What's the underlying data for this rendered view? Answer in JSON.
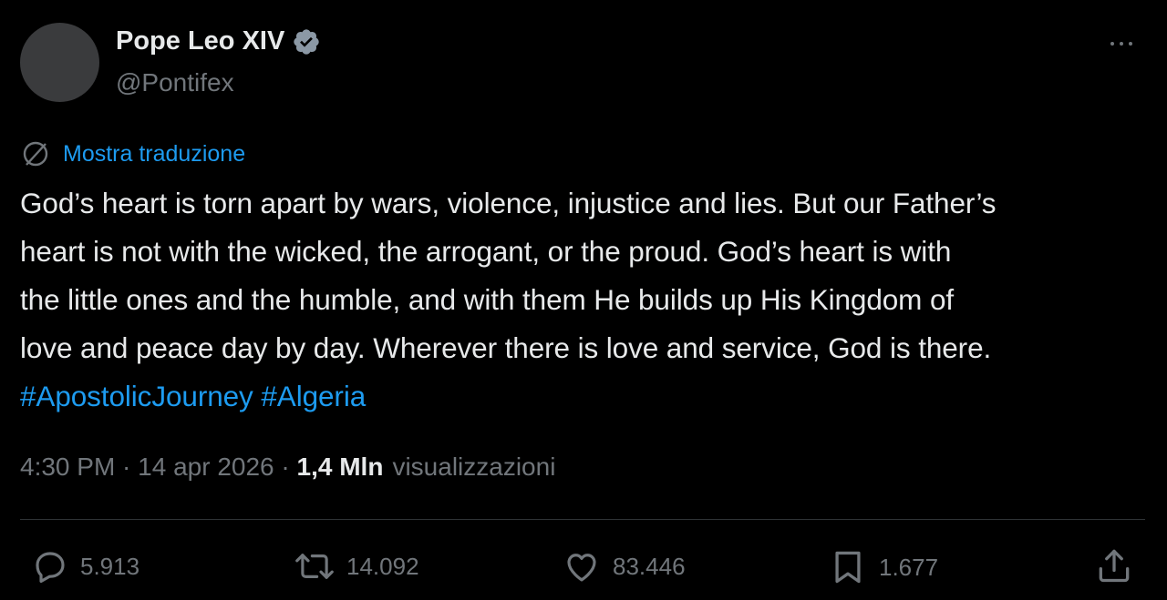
{
  "author": {
    "name": "Pope Leo XIV",
    "handle": "@Pontifex",
    "verified_icon": "verified-badge-icon"
  },
  "translate": {
    "label": "Mostra traduzione",
    "icon": "globe-icon"
  },
  "tweet": {
    "text": "God’s heart is torn apart by wars, violence, injustice and lies. But our Father’s\nheart is not with the wicked, the arrogant, or the proud. God’s heart is with\nthe little ones and the humble, and with them He builds up His Kingdom of\nlove and peace day by day. Wherever there is love and service, God is there.\n",
    "hashtags": [
      "#ApostolicJourney",
      "#Algeria"
    ]
  },
  "meta": {
    "time": "4:30 PM",
    "separator": " · ",
    "date": "14 apr 2026",
    "separator2": " · ",
    "views_count": "1,4 Mln",
    "views_label": "visualizzazioni"
  },
  "actions": {
    "replies": "5.913",
    "reposts": "14.092",
    "likes": "83.446",
    "bookmarks": "1.677"
  },
  "colors": {
    "background": "#000000",
    "text": "#e7e9ea",
    "secondary": "#71767b",
    "accent": "#1d9bf0",
    "divider": "#2f3336"
  }
}
